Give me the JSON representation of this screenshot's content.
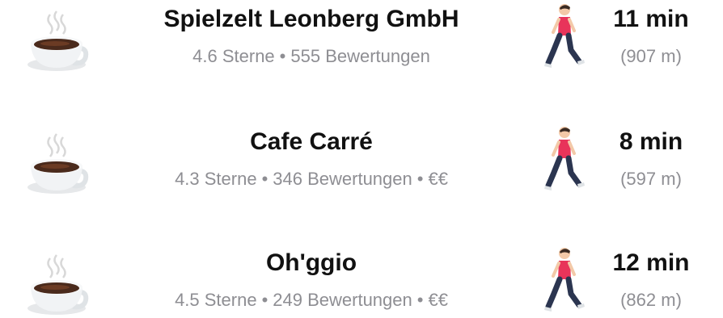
{
  "places": [
    {
      "icon": "hot-beverage-icon",
      "name": "Spielzelt Leonberg GmbH",
      "rating": "4.6 Sterne",
      "reviews": "555 Bewertungen",
      "price": "",
      "walk_icon": "walking-person-icon",
      "time": "11 min",
      "distance": "(907 m)"
    },
    {
      "icon": "hot-beverage-icon",
      "name": "Cafe Carré",
      "rating": "4.3 Sterne",
      "reviews": "346 Bewertungen",
      "price": "€€",
      "walk_icon": "walking-person-icon",
      "time": "8 min",
      "distance": "(597 m)"
    },
    {
      "icon": "hot-beverage-icon",
      "name": "Oh'ggio",
      "rating": "4.5 Sterne",
      "reviews": "249 Bewertungen",
      "price": "€€",
      "walk_icon": "walking-person-icon",
      "time": "12 min",
      "distance": "(862 m)"
    }
  ],
  "separator": "•",
  "colors": {
    "title": "#111111",
    "secondary": "#8e8e93",
    "shirt": "#e8345a",
    "pants": "#2b3550"
  }
}
